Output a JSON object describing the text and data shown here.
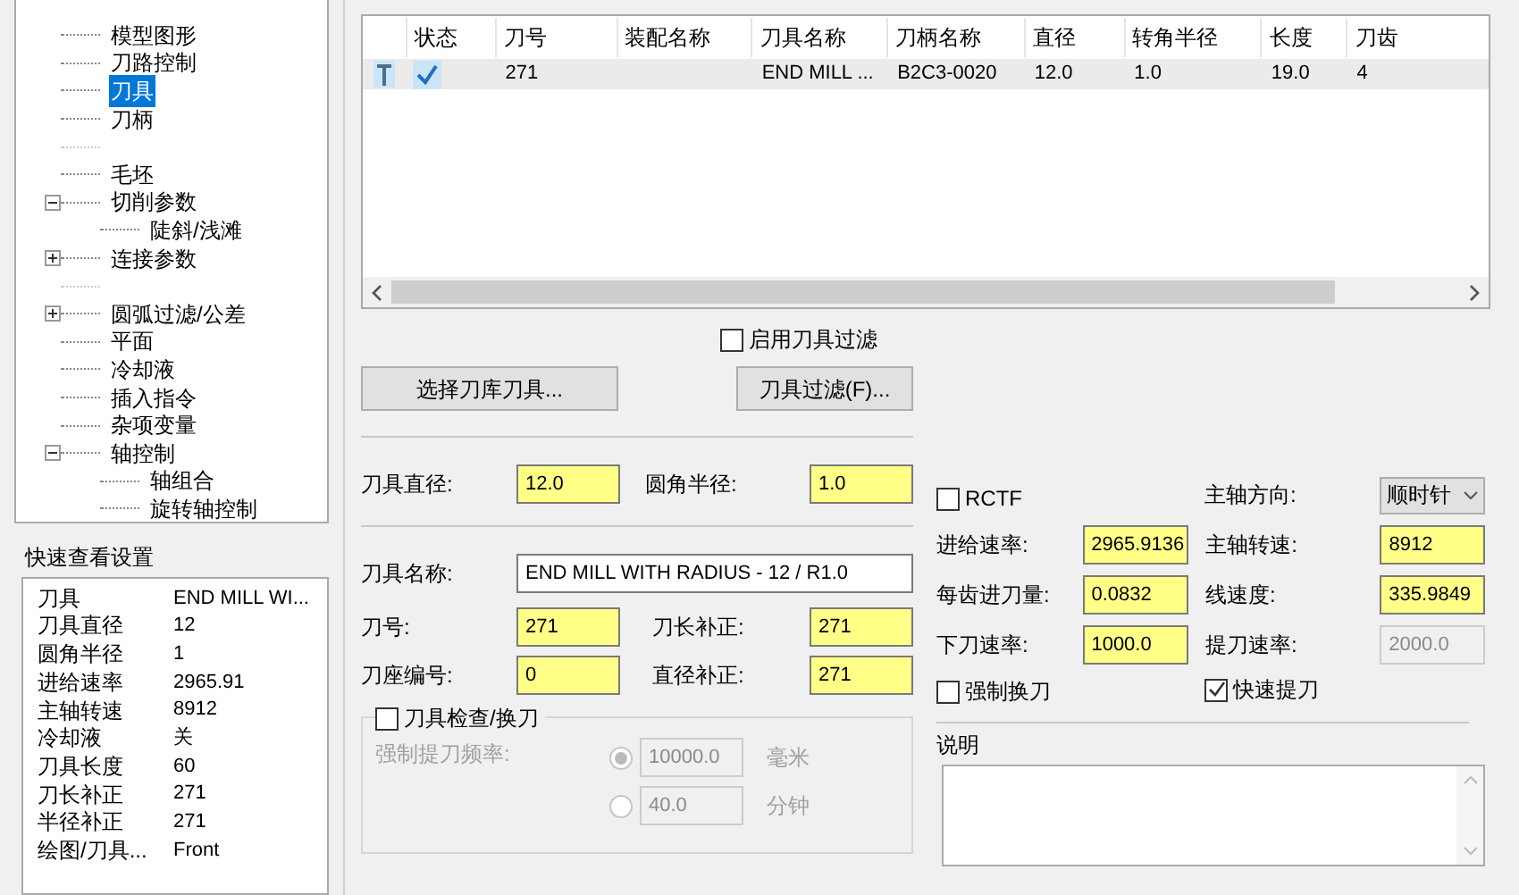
{
  "tree": {
    "items": [
      {
        "kind": "node",
        "label": "模型图形",
        "selected": false
      },
      {
        "kind": "node",
        "label": "刀路控制",
        "selected": false
      },
      {
        "kind": "node",
        "label": "刀具",
        "selected": true
      },
      {
        "kind": "node",
        "label": "刀柄",
        "selected": false
      },
      {
        "kind": "spacer"
      },
      {
        "kind": "node",
        "label": "毛坯",
        "selected": false
      },
      {
        "kind": "node",
        "label": "切削参数",
        "selected": false,
        "expanded": true,
        "children": [
          {
            "kind": "node",
            "label": "陡斜/浅滩",
            "selected": false
          }
        ]
      },
      {
        "kind": "node",
        "label": "连接参数",
        "selected": false,
        "expanded": false
      },
      {
        "kind": "spacer"
      },
      {
        "kind": "node",
        "label": "圆弧过滤/公差",
        "selected": false,
        "expanded": false
      },
      {
        "kind": "node",
        "label": "平面",
        "selected": false
      },
      {
        "kind": "node",
        "label": "冷却液",
        "selected": false
      },
      {
        "kind": "node",
        "label": "插入指令",
        "selected": false
      },
      {
        "kind": "node",
        "label": "杂项变量",
        "selected": false
      },
      {
        "kind": "node",
        "label": "轴控制",
        "selected": false,
        "expanded": true,
        "children": [
          {
            "kind": "node",
            "label": "轴组合",
            "selected": false
          },
          {
            "kind": "node",
            "label": "旋转轴控制",
            "selected": false
          }
        ]
      }
    ]
  },
  "quick_view": {
    "title": "快速查看设置",
    "rows": [
      {
        "label": "刀具",
        "value": "END MILL WI..."
      },
      {
        "label": "刀具直径",
        "value": "12"
      },
      {
        "label": "圆角半径",
        "value": "1"
      },
      {
        "label": "进给速率",
        "value": "2965.91"
      },
      {
        "label": "主轴转速",
        "value": "8912"
      },
      {
        "label": "冷却液",
        "value": "关"
      },
      {
        "label": "刀具长度",
        "value": "60"
      },
      {
        "label": "刀长补正",
        "value": "271"
      },
      {
        "label": "半径补正",
        "value": "271"
      },
      {
        "label": "绘图/刀具...",
        "value": "Front"
      }
    ]
  },
  "table": {
    "columns": [
      "状态",
      "刀号",
      "装配名称",
      "刀具名称",
      "刀柄名称",
      "直径",
      "转角半径",
      "长度",
      "刀齿"
    ],
    "rows": [
      {
        "selected": true,
        "checked": true,
        "tool_number": "271",
        "tool_name": "END MILL ...",
        "holder_name": "B2C3-0020",
        "diameter": "12.0",
        "corner_radius": "1.0",
        "length": "19.0",
        "flutes": "4"
      }
    ]
  },
  "tool_filter": {
    "label": "启用刀具过滤",
    "checked": false
  },
  "buttons": [
    "选择刀库刀具...",
    "刀具过滤(F)..."
  ],
  "geometry": [
    {
      "label": "刀具直径:",
      "value": "12.0",
      "highlighted": true
    },
    {
      "label": "圆角半径:",
      "value": "1.0",
      "highlighted": true
    }
  ],
  "tool_name": {
    "label": "刀具名称:",
    "value": "END MILL WITH RADIUS - 12 / R1.0",
    "highlighted": false
  },
  "numbers": [
    [
      {
        "label": "刀号:",
        "value": "271",
        "highlighted": true
      },
      {
        "label": "刀长补正:",
        "value": "271",
        "highlighted": true
      }
    ],
    [
      {
        "label": "刀座编号:",
        "value": "0",
        "highlighted": true
      },
      {
        "label": "直径补正:",
        "value": "271",
        "highlighted": true
      }
    ]
  ],
  "tool_check": {
    "label": "刀具检查/换刀",
    "checked": false,
    "frequency_label": "强制提刀频率:",
    "options": [
      {
        "value": "10000.0",
        "unit": "毫米",
        "selected": true
      },
      {
        "value": "40.0",
        "unit": "分钟",
        "selected": false
      }
    ]
  },
  "feeds": [
    [
      {
        "kind": "checkbox",
        "label": "RCTF",
        "checked": false
      },
      {
        "kind": "dropdown",
        "label": "主轴方向:",
        "value": "顺时针"
      }
    ],
    [
      {
        "kind": "field",
        "label": "进给速率:",
        "value": "2965.9136",
        "highlighted": true
      },
      {
        "kind": "field",
        "label": "主轴转速:",
        "value": "8912",
        "highlighted": true
      }
    ],
    [
      {
        "kind": "field",
        "label": "每齿进刀量:",
        "value": "0.0832",
        "highlighted": true
      },
      {
        "kind": "field",
        "label": "线速度:",
        "value": "335.9849",
        "highlighted": true
      }
    ],
    [
      {
        "kind": "field",
        "label": "下刀速率:",
        "value": "1000.0",
        "highlighted": true
      },
      {
        "kind": "field",
        "label": "提刀速率:",
        "value": "2000.0",
        "disabled": true
      }
    ]
  ],
  "options": [
    {
      "label": "强制换刀",
      "checked": false
    },
    {
      "label": "快速提刀",
      "checked": true
    }
  ],
  "notes": {
    "label": "说明"
  }
}
